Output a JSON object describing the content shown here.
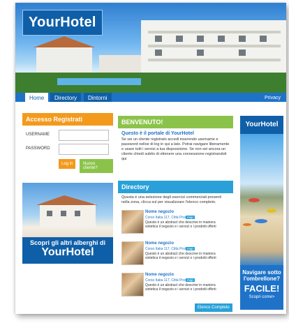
{
  "header": {
    "logo": "YourHotel",
    "nav": [
      "Home",
      "Directory",
      "Dintorni"
    ],
    "privacy": "Privacy"
  },
  "login": {
    "title": "Accesso Registrati",
    "username_label": "USERNAME",
    "password_label": "PASSWORD",
    "login_button": "Log in",
    "register_button": "Nuovo cliente?"
  },
  "promo": {
    "line1": "Scopri gli altri alberghi di",
    "line2": "YourHotel"
  },
  "welcome": {
    "title": "BENVENUTO!",
    "intro": "Questo è il portale di YourHotel",
    "body": "Se sei un cliente registrato accedi inserendo username e password nelloe di log in qui a lato. Potrai navigare liberamente e usare tutti i servizi a tua disposizione. Se non sei ancora un cliente chiedi subito di ottenere una connessione registrandoti qui"
  },
  "directory": {
    "title": "Directory",
    "desc": "Questa è una selezione degli esercizi commerciali presenti nella zona, clicca sul per visualizzare l'elenco completo.",
    "entries": [
      {
        "name": "Nome negozio",
        "addr": "Corso Italia 117, Città Prov.",
        "badge": "map",
        "text": "Questo è un abstract che descrive in maniera sintetica il negozio e i servizi o i prodotti offerti"
      },
      {
        "name": "Nome negozio",
        "addr": "Corso Italia 117, Città Prov.",
        "badge": "map",
        "text": "Questo è un abstract che descrive in maniera sintetica il negozio e i servizi o i prodotti offerti"
      },
      {
        "name": "Nome negozio",
        "addr": "Corso Italia 117, Città Prov.",
        "badge": "map",
        "text": "Questo è un abstract che descrive in maniera sintetica il negozio e i servizi o i prodotti offerti"
      }
    ],
    "more_button": "Elenco Completo"
  },
  "sidebar_ad": {
    "logo": "YourHotel",
    "line1": "Navigare sotto l'ombrellone?",
    "line2": "FACILE!",
    "line3": "Scopri come>"
  }
}
